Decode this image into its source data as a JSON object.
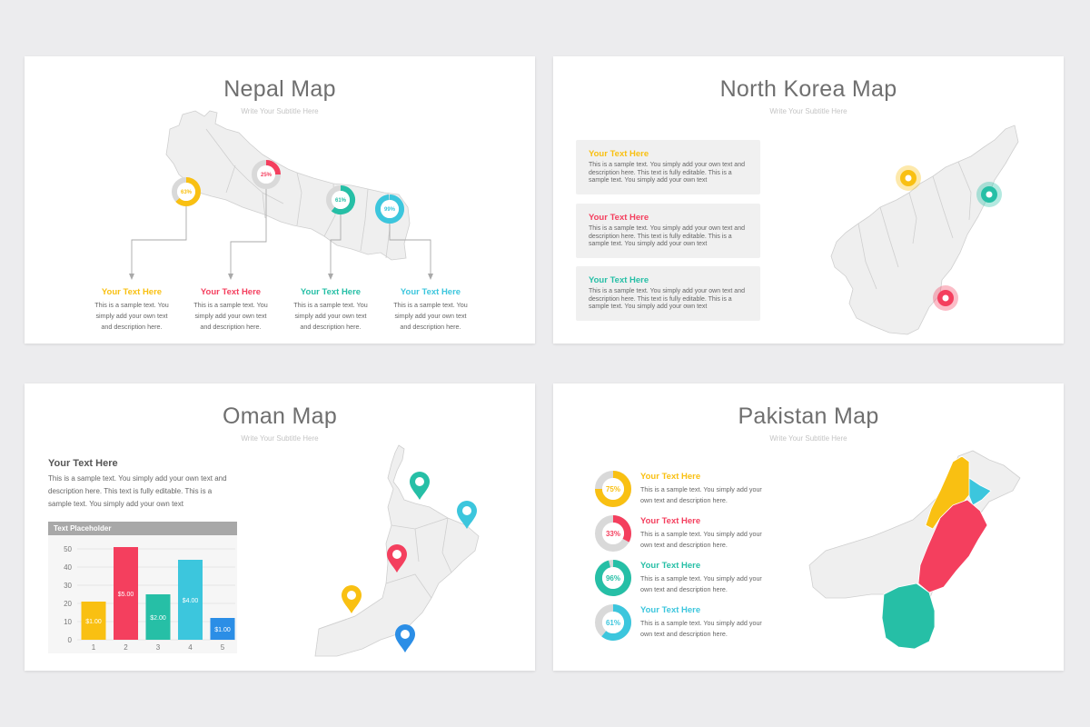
{
  "colors": {
    "yellow": "#f9c012",
    "red": "#f43f5e",
    "teal": "#26bfa6",
    "cyan": "#3cc6dd",
    "blue": "#2b8ee6",
    "map": "#efefef",
    "outline": "#c9c9c9"
  },
  "nepal": {
    "title": "Nepal Map",
    "subtitle": "Write Your Subtitle Here",
    "markers": [
      {
        "percent": 63,
        "label": "63%",
        "color": "yellow"
      },
      {
        "percent": 25,
        "label": "25%",
        "color": "red"
      },
      {
        "percent": 61,
        "label": "61%",
        "color": "teal"
      },
      {
        "percent": 99,
        "label": "99%",
        "color": "cyan"
      }
    ],
    "items": [
      {
        "title": "Your Text Here",
        "color": "yellow",
        "desc": "This is a sample text. You simply add your own text and description here."
      },
      {
        "title": "Your Text Here",
        "color": "red",
        "desc": "This is a sample text. You simply add your own text and description here."
      },
      {
        "title": "Your Text Here",
        "color": "teal",
        "desc": "This is a sample text. You simply add your own text and description here."
      },
      {
        "title": "Your Text Here",
        "color": "cyan",
        "desc": "This is a sample text. You simply add your own text and description here."
      }
    ]
  },
  "north_korea": {
    "title": "North Korea Map",
    "subtitle": "Write Your Subtitle Here",
    "items": [
      {
        "title": "Your Text Here",
        "color": "yellow",
        "desc": "This is a sample text. You simply add your own text and description here. This text is fully editable. This is a sample text. You simply add your own text"
      },
      {
        "title": "Your Text Here",
        "color": "red",
        "desc": "This is a sample text. You simply add your own text and description here. This text is fully editable. This is a sample text. You simply add your own text"
      },
      {
        "title": "Your Text Here",
        "color": "teal",
        "desc": "This is a sample text. You simply add your own text and description here. This text is fully editable. This is a sample text. You simply add your own text"
      }
    ],
    "markers": [
      {
        "color": "yellow"
      },
      {
        "color": "teal"
      },
      {
        "color": "red"
      }
    ]
  },
  "oman": {
    "title": "Oman Map",
    "subtitle": "Write Your Subtitle Here",
    "heading": "Your Text Here",
    "desc": "This is a sample text. You simply add your own text and description here. This text is fully editable. This is a sample text. You simply add your own text",
    "chart_header": "Text Placeholder",
    "pins": [
      {
        "color": "teal"
      },
      {
        "color": "cyan"
      },
      {
        "color": "red"
      },
      {
        "color": "yellow"
      },
      {
        "color": "blue"
      }
    ]
  },
  "pakistan": {
    "title": "Pakistan Map",
    "subtitle": "Write Your Subtitle Here",
    "items": [
      {
        "percent": 75,
        "label": "75%",
        "title": "Your Text Here",
        "color": "yellow",
        "desc": "This is a sample text. You simply add your own text and description here."
      },
      {
        "percent": 33,
        "label": "33%",
        "title": "Your Text Here",
        "color": "red",
        "desc": "This is a sample text. You simply add your own text and description here."
      },
      {
        "percent": 96,
        "label": "96%",
        "title": "Your Text Here",
        "color": "teal",
        "desc": "This is a sample text. You simply add your own text and description here."
      },
      {
        "percent": 61,
        "label": "61%",
        "title": "Your Text Here",
        "color": "cyan",
        "desc": "This is a sample text. You simply add your own text and description here."
      }
    ]
  },
  "chart_data": {
    "type": "bar",
    "title": "Text Placeholder",
    "categories": [
      "1",
      "2",
      "3",
      "4",
      "5"
    ],
    "values": [
      21,
      51,
      25,
      44,
      12
    ],
    "data_labels": [
      "$1.00",
      "$5.00",
      "$2.00",
      "$4.00",
      "$1.00"
    ],
    "bar_colors": [
      "yellow",
      "red",
      "teal",
      "cyan",
      "blue"
    ],
    "yticks": [
      "0",
      "10",
      "20",
      "30",
      "40",
      "50"
    ],
    "ylim": [
      0,
      55
    ],
    "grid": true
  }
}
